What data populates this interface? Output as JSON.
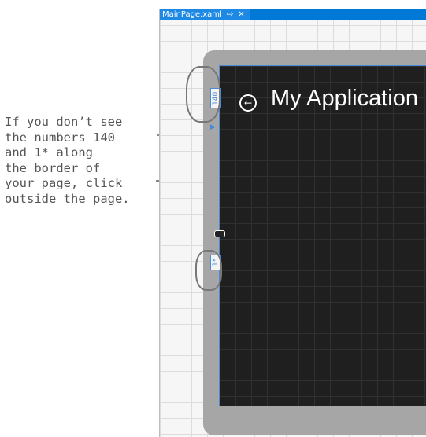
{
  "tab": {
    "title": "MainPage.xaml",
    "pin_glyph": "⇨",
    "close_glyph": "✕"
  },
  "page": {
    "title": "My Application",
    "back_glyph": "←"
  },
  "row_markers": {
    "first": "140",
    "second": "1*"
  },
  "annotation": {
    "lines": [
      "If you don’t see",
      "the numbers 140",
      "and 1* along",
      "the border of",
      "your page, click",
      "outside the page."
    ]
  },
  "colors": {
    "accent": "#0079d6",
    "page_background": "#1f1f1f",
    "selection_border": "#4a88d8"
  }
}
